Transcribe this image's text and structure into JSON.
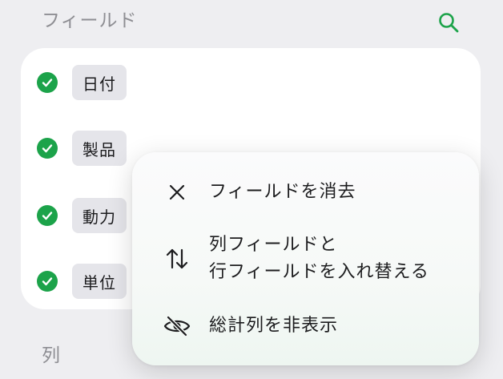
{
  "header": {
    "title": "フィールド"
  },
  "search": {
    "icon": "search-icon",
    "accent": "#1ca34a"
  },
  "fields": [
    {
      "label": "日付",
      "checked": true
    },
    {
      "label": "製品",
      "checked": true
    },
    {
      "label": "動力",
      "checked": true
    },
    {
      "label": "単位",
      "checked": true
    }
  ],
  "columns_section": {
    "title": "列"
  },
  "context_menu": {
    "items": [
      {
        "icon": "close-icon",
        "label": "フィールドを消去"
      },
      {
        "icon": "swap-arrows-icon",
        "label_line1": "列フィールドと",
        "label_line2": "行フィールドを入れ替える"
      },
      {
        "icon": "eye-slash-icon",
        "label": "総計列を非表示"
      }
    ]
  }
}
